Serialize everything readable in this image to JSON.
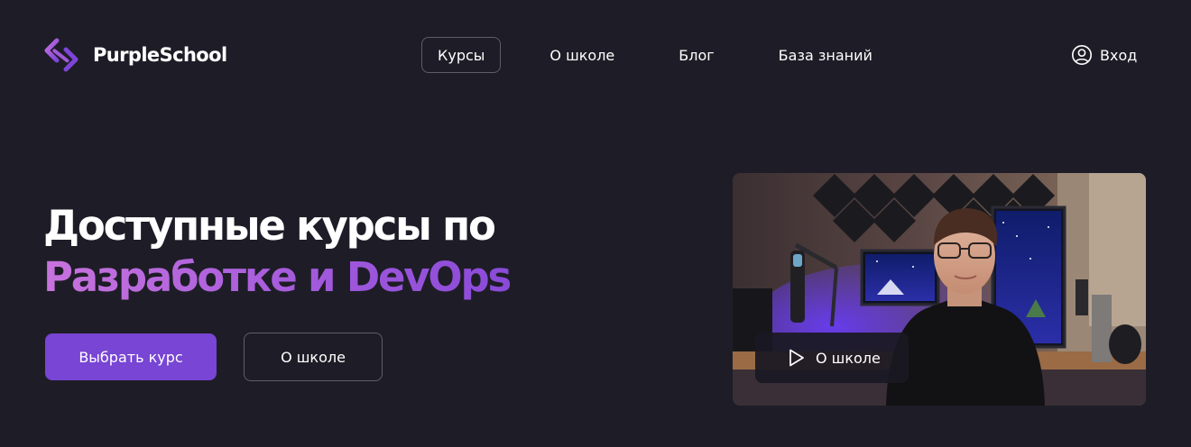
{
  "header": {
    "logo_text": "PurpleSchool",
    "nav": [
      {
        "label": "Курсы",
        "active": true
      },
      {
        "label": "О школе",
        "active": false
      },
      {
        "label": "Блог",
        "active": false
      },
      {
        "label": "База знаний",
        "active": false
      }
    ],
    "login_label": "Вход"
  },
  "hero": {
    "title_line1": "Доступные курсы по",
    "title_line2": "Разработке и DevOps",
    "primary_button": "Выбрать курс",
    "secondary_button": "О школе"
  },
  "video": {
    "play_label": "О школе"
  },
  "colors": {
    "background": "#1e1d27",
    "accent": "#7845d4",
    "gradient_start": "#c873dd",
    "gradient_end": "#8a4ad8",
    "border": "#5e5c6a"
  },
  "icons": {
    "logo": "purple-chevron-logo-icon",
    "login": "user-circle-icon",
    "play": "play-icon"
  }
}
